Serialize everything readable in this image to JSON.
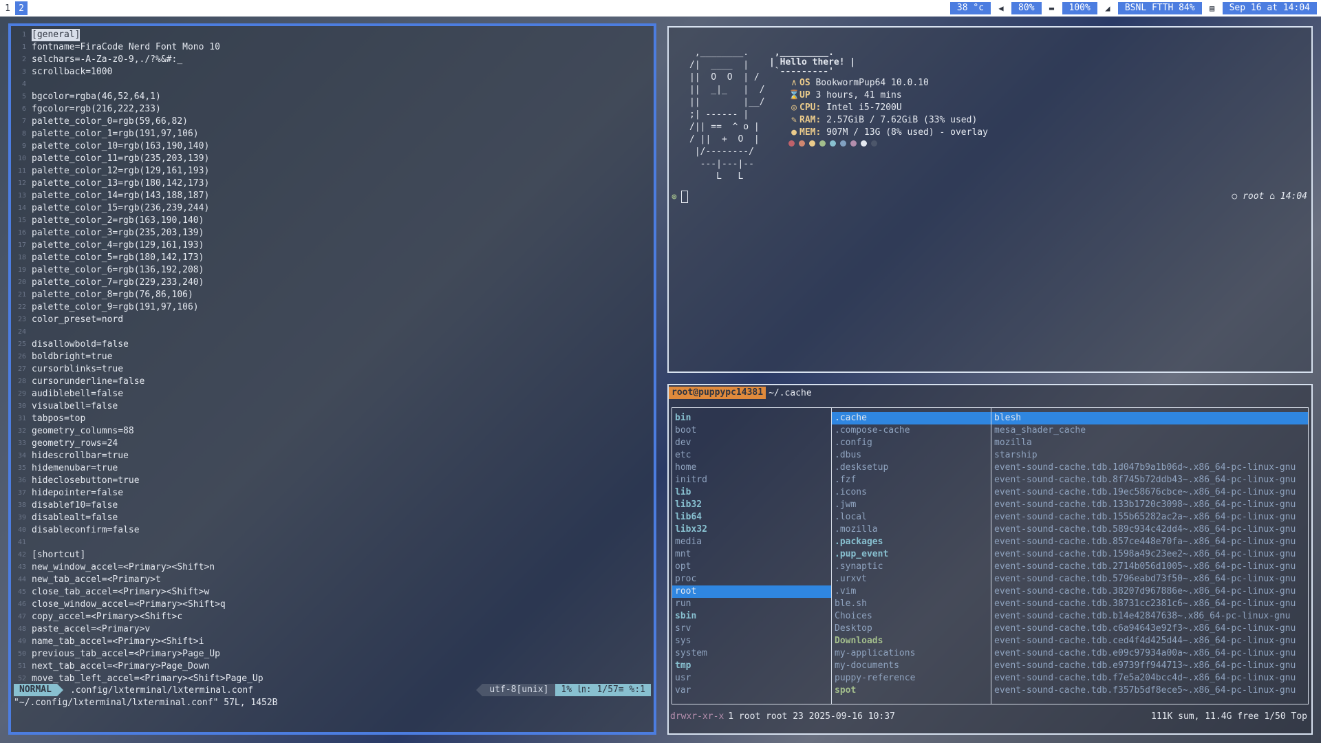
{
  "topbar": {
    "workspaces": [
      "1",
      "2"
    ],
    "active_workspace": "2",
    "temp": "38 °c",
    "volume": "80%",
    "battery": "100%",
    "wifi": "BSNL FTTH 84%",
    "clock": "Sep 16 at 14:04"
  },
  "editor": {
    "lines": [
      {
        "n": "1",
        "t": "[general]"
      },
      {
        "n": "1",
        "t": "fontname=FiraCode Nerd Font Mono 10"
      },
      {
        "n": "2",
        "t": "selchars=-A-Za-z0-9,./?%&#:_"
      },
      {
        "n": "3",
        "t": "scrollback=1000"
      },
      {
        "n": "4",
        "t": ""
      },
      {
        "n": "5",
        "t": "bgcolor=rgba(46,52,64,1)"
      },
      {
        "n": "6",
        "t": "fgcolor=rgb(216,222,233)"
      },
      {
        "n": "7",
        "t": "palette_color_0=rgb(59,66,82)"
      },
      {
        "n": "8",
        "t": "palette_color_1=rgb(191,97,106)"
      },
      {
        "n": "9",
        "t": "palette_color_10=rgb(163,190,140)"
      },
      {
        "n": "10",
        "t": "palette_color_11=rgb(235,203,139)"
      },
      {
        "n": "11",
        "t": "palette_color_12=rgb(129,161,193)"
      },
      {
        "n": "12",
        "t": "palette_color_13=rgb(180,142,173)"
      },
      {
        "n": "13",
        "t": "palette_color_14=rgb(143,188,187)"
      },
      {
        "n": "14",
        "t": "palette_color_15=rgb(236,239,244)"
      },
      {
        "n": "15",
        "t": "palette_color_2=rgb(163,190,140)"
      },
      {
        "n": "16",
        "t": "palette_color_3=rgb(235,203,139)"
      },
      {
        "n": "17",
        "t": "palette_color_4=rgb(129,161,193)"
      },
      {
        "n": "18",
        "t": "palette_color_5=rgb(180,142,173)"
      },
      {
        "n": "19",
        "t": "palette_color_6=rgb(136,192,208)"
      },
      {
        "n": "20",
        "t": "palette_color_7=rgb(229,233,240)"
      },
      {
        "n": "21",
        "t": "palette_color_8=rgb(76,86,106)"
      },
      {
        "n": "22",
        "t": "palette_color_9=rgb(191,97,106)"
      },
      {
        "n": "23",
        "t": "color_preset=nord"
      },
      {
        "n": "24",
        "t": ""
      },
      {
        "n": "25",
        "t": "disallowbold=false"
      },
      {
        "n": "26",
        "t": "boldbright=true"
      },
      {
        "n": "27",
        "t": "cursorblinks=true"
      },
      {
        "n": "28",
        "t": "cursorunderline=false"
      },
      {
        "n": "29",
        "t": "audiblebell=false"
      },
      {
        "n": "30",
        "t": "visualbell=false"
      },
      {
        "n": "31",
        "t": "tabpos=top"
      },
      {
        "n": "32",
        "t": "geometry_columns=88"
      },
      {
        "n": "33",
        "t": "geometry_rows=24"
      },
      {
        "n": "34",
        "t": "hidescrollbar=true"
      },
      {
        "n": "35",
        "t": "hidemenubar=true"
      },
      {
        "n": "36",
        "t": "hideclosebutton=true"
      },
      {
        "n": "37",
        "t": "hidepointer=false"
      },
      {
        "n": "38",
        "t": "disablef10=false"
      },
      {
        "n": "39",
        "t": "disablealt=false"
      },
      {
        "n": "40",
        "t": "disableconfirm=false"
      },
      {
        "n": "41",
        "t": ""
      },
      {
        "n": "42",
        "t": "[shortcut]"
      },
      {
        "n": "43",
        "t": "new_window_accel=<Primary><Shift>n"
      },
      {
        "n": "44",
        "t": "new_tab_accel=<Primary>t"
      },
      {
        "n": "45",
        "t": "close_tab_accel=<Primary><Shift>w"
      },
      {
        "n": "46",
        "t": "close_window_accel=<Primary><Shift>q"
      },
      {
        "n": "47",
        "t": "copy_accel=<Primary><Shift>c"
      },
      {
        "n": "48",
        "t": "paste_accel=<Primary>v"
      },
      {
        "n": "49",
        "t": "name_tab_accel=<Primary><Shift>i"
      },
      {
        "n": "50",
        "t": "previous_tab_accel=<Primary>Page_Up"
      },
      {
        "n": "51",
        "t": "next_tab_accel=<Primary>Page_Down"
      },
      {
        "n": "52",
        "t": "move_tab_left_accel=<Primary><Shift>Page_Up"
      }
    ],
    "mode": "NORMAL",
    "filename": ".config/lxterminal/lxterminal.conf",
    "encoding": "utf-8[unix]",
    "position": "1% ㏑: 1/57≡ %:1",
    "message": "\"~/.config/lxterminal/lxterminal.conf\" 57L, 1452B"
  },
  "fetch": {
    "ascii": " ,________.\n/|  ____  |\n||  O  O  | /\n||  _|_   |  /\n||        |__/\n;| ------ |\n/|| ==  ^ o |\n/ ||  +  O  |\n |/--------/\n  ---|---|--\n     L   L",
    "bubble": " ,_________.\n| Hello there! |\n `---------'",
    "info": [
      {
        "icon": "∧",
        "key": "OS",
        "val": "BookwormPup64 10.0.10"
      },
      {
        "icon": "⌛",
        "key": "UP",
        "val": "3 hours, 41 mins"
      },
      {
        "icon": "◎",
        "key": "CPU:",
        "val": "Intel i5-7200U"
      },
      {
        "icon": "✎",
        "key": "RAM:",
        "val": "2.57GiB / 7.62GiB (33% used)"
      },
      {
        "icon": "●",
        "key": "MEM:",
        "val": "907M / 13G (8% used) - overlay"
      }
    ],
    "dot_colors": [
      "#bf616a",
      "#d08770",
      "#ebcb8b",
      "#a3be8c",
      "#88c0d0",
      "#81a1c1",
      "#b48ead",
      "#e5e9f0",
      "#4c566a"
    ],
    "prompt_right": "○ root ⌂ 14:04"
  },
  "files": {
    "userhost": "root@puppypc14381",
    "cwd": "~/.cache",
    "col1": [
      {
        "name": "bin",
        "cls": "dir-bold"
      },
      {
        "name": "boot",
        "cls": "faint"
      },
      {
        "name": "dev",
        "cls": "faint"
      },
      {
        "name": "etc",
        "cls": "faint"
      },
      {
        "name": "home",
        "cls": "faint"
      },
      {
        "name": "initrd",
        "cls": "faint"
      },
      {
        "name": "lib",
        "cls": "dir-bold"
      },
      {
        "name": "lib32",
        "cls": "dir-bold"
      },
      {
        "name": "lib64",
        "cls": "dir-bold"
      },
      {
        "name": "libx32",
        "cls": "dir-bold"
      },
      {
        "name": "media",
        "cls": "faint"
      },
      {
        "name": "mnt",
        "cls": "faint"
      },
      {
        "name": "opt",
        "cls": "faint"
      },
      {
        "name": "proc",
        "cls": "faint"
      },
      {
        "name": "root",
        "cls": "sel"
      },
      {
        "name": "run",
        "cls": "faint"
      },
      {
        "name": "sbin",
        "cls": "dir-bold"
      },
      {
        "name": "srv",
        "cls": "faint"
      },
      {
        "name": "sys",
        "cls": "faint"
      },
      {
        "name": "system",
        "cls": "faint"
      },
      {
        "name": "tmp",
        "cls": "dir-bold"
      },
      {
        "name": "usr",
        "cls": "faint"
      },
      {
        "name": "var",
        "cls": "faint"
      }
    ],
    "col2": [
      {
        "name": ".cache",
        "cls": "sel"
      },
      {
        "name": ".compose-cache",
        "cls": "faint"
      },
      {
        "name": ".config",
        "cls": "faint"
      },
      {
        "name": ".dbus",
        "cls": "faint"
      },
      {
        "name": ".desksetup",
        "cls": "faint"
      },
      {
        "name": ".fzf",
        "cls": "faint"
      },
      {
        "name": ".icons",
        "cls": "faint"
      },
      {
        "name": ".jwm",
        "cls": "faint"
      },
      {
        "name": ".local",
        "cls": "faint"
      },
      {
        "name": ".mozilla",
        "cls": "faint"
      },
      {
        "name": ".packages",
        "cls": "dir-bold"
      },
      {
        "name": ".pup_event",
        "cls": "dir-bold"
      },
      {
        "name": ".synaptic",
        "cls": "faint"
      },
      {
        "name": ".urxvt",
        "cls": "faint"
      },
      {
        "name": ".vim",
        "cls": "faint"
      },
      {
        "name": "ble.sh",
        "cls": "faint"
      },
      {
        "name": "Choices",
        "cls": "faint"
      },
      {
        "name": "Desktop",
        "cls": "faint"
      },
      {
        "name": "Downloads",
        "cls": "exe"
      },
      {
        "name": "my-applications",
        "cls": "faint"
      },
      {
        "name": "my-documents",
        "cls": "faint"
      },
      {
        "name": "puppy-reference",
        "cls": "faint"
      },
      {
        "name": "spot",
        "cls": "exe"
      }
    ],
    "col3": [
      {
        "name": "blesh",
        "cls": "sel"
      },
      {
        "name": "mesa_shader_cache",
        "cls": "faint"
      },
      {
        "name": "mozilla",
        "cls": "faint"
      },
      {
        "name": "starship",
        "cls": "faint"
      },
      {
        "name": "event-sound-cache.tdb.1d047b9a1b06d~.x86_64-pc-linux-gnu",
        "cls": "faint"
      },
      {
        "name": "event-sound-cache.tdb.8f745b72ddb43~.x86_64-pc-linux-gnu",
        "cls": "faint"
      },
      {
        "name": "event-sound-cache.tdb.19ec58676cbce~.x86_64-pc-linux-gnu",
        "cls": "faint"
      },
      {
        "name": "event-sound-cache.tdb.133b1720c3098~.x86_64-pc-linux-gnu",
        "cls": "faint"
      },
      {
        "name": "event-sound-cache.tdb.155b65282ac2a~.x86_64-pc-linux-gnu",
        "cls": "faint"
      },
      {
        "name": "event-sound-cache.tdb.589c934c42dd4~.x86_64-pc-linux-gnu",
        "cls": "faint"
      },
      {
        "name": "event-sound-cache.tdb.857ce448e70fa~.x86_64-pc-linux-gnu",
        "cls": "faint"
      },
      {
        "name": "event-sound-cache.tdb.1598a49c23ee2~.x86_64-pc-linux-gnu",
        "cls": "faint"
      },
      {
        "name": "event-sound-cache.tdb.2714b056d1005~.x86_64-pc-linux-gnu",
        "cls": "faint"
      },
      {
        "name": "event-sound-cache.tdb.5796eabd73f50~.x86_64-pc-linux-gnu",
        "cls": "faint"
      },
      {
        "name": "event-sound-cache.tdb.38207d967886e~.x86_64-pc-linux-gnu",
        "cls": "faint"
      },
      {
        "name": "event-sound-cache.tdb.38731cc2381c6~.x86_64-pc-linux-gnu",
        "cls": "faint"
      },
      {
        "name": "event-sound-cache.tdb.b14e42847638~.x86_64-pc-linux-gnu",
        "cls": "faint"
      },
      {
        "name": "event-sound-cache.tdb.c6a94643e92f3~.x86_64-pc-linux-gnu",
        "cls": "faint"
      },
      {
        "name": "event-sound-cache.tdb.ced4f4d425d44~.x86_64-pc-linux-gnu",
        "cls": "faint"
      },
      {
        "name": "event-sound-cache.tdb.e09c97934a00a~.x86_64-pc-linux-gnu",
        "cls": "faint"
      },
      {
        "name": "event-sound-cache.tdb.e9739ff944713~.x86_64-pc-linux-gnu",
        "cls": "faint"
      },
      {
        "name": "event-sound-cache.tdb.f7e5a204bcc4d~.x86_64-pc-linux-gnu",
        "cls": "faint"
      },
      {
        "name": "event-sound-cache.tdb.f357b5df8ece5~.x86_64-pc-linux-gnu",
        "cls": "faint"
      }
    ],
    "footer_perm": "drwxr-xr-x",
    "footer_meta": "1 root root 23 2025-09-16 10:37",
    "footer_right": "111K sum, 11.4G free  1/50  Top"
  }
}
